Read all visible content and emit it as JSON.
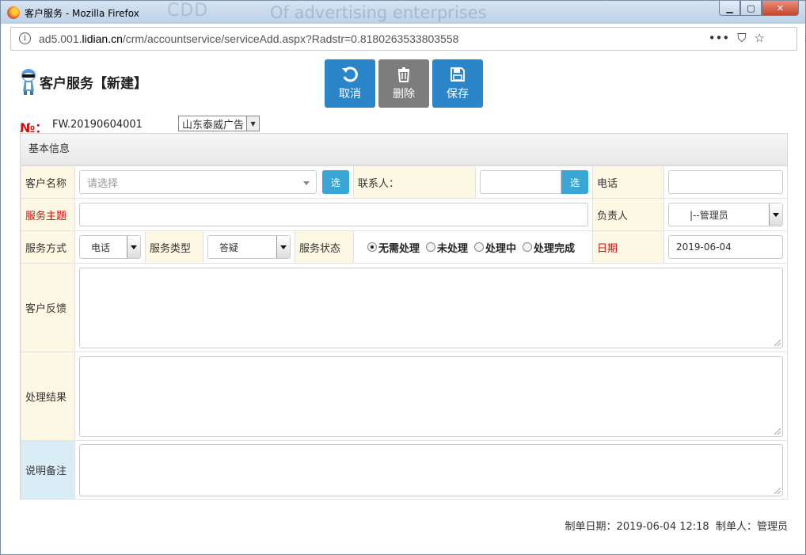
{
  "window": {
    "title": "客户服务 - Mozilla Firefox",
    "watermark_a": "CDD",
    "watermark_b": "Of advertising enterprises",
    "controls": {
      "minimize": "▁",
      "maximize": "▢",
      "close": "✕"
    }
  },
  "browser": {
    "url_prefix": "ad5.001.",
    "url_domain": "lidian.cn",
    "url_path": "/crm/accountservice/serviceAdd.aspx?Radstr=0.8180263533803558",
    "icons": [
      "info-icon",
      "more-icon",
      "pocket-icon",
      "bookmark-star-icon",
      "hamburger-menu-icon"
    ],
    "more_glyph": "•••",
    "pocket_glyph": "⛉",
    "star_glyph": "☆",
    "menu_glyph": "≡",
    "info_glyph": "i"
  },
  "page": {
    "title": "客户服务【新建】",
    "toolbar": {
      "cancel_label": "取消",
      "delete_label": "删除",
      "save_label": "保存"
    },
    "number_label": "№：",
    "number_value": "FW.20190604001",
    "company_value": "山东泰威广告"
  },
  "panel": {
    "heading": "基本信息",
    "customer_label": "客户名称",
    "customer_placeholder": "请选择",
    "pick_label": "选",
    "contact_label": "联系人：",
    "contact_value": "",
    "phone_label": "电话",
    "phone_value": "",
    "subject_label": "服务主题",
    "subject_value": "",
    "owner_label": "负责人",
    "owner_value": "|--管理员",
    "method_label": "服务方式",
    "method_value": "电话",
    "type_label": "服务类型",
    "type_value": "答疑",
    "status_label": "服务状态",
    "status_options": [
      "无需处理",
      "未处理",
      "处理中",
      "处理完成"
    ],
    "status_selected": "无需处理",
    "date_label": "日期",
    "date_value": "2019-06-04",
    "feedback_label": "客户反馈",
    "result_label": "处理结果",
    "notes_label": "说明备注"
  },
  "footer": {
    "created_label": "制单日期：",
    "created_value": "2019-06-04 12:18",
    "creator_label": "制单人：",
    "creator_value": "管理员"
  },
  "colors": {
    "accent": "#2b86c9",
    "pick_button": "#39a6d6",
    "label_bg": "#fcf8e3",
    "required_red": "#cc1010",
    "notes_bg": "#d9edf7"
  }
}
